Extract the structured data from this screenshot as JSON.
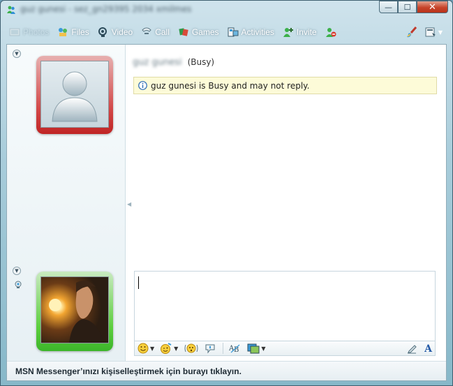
{
  "window": {
    "title": "guz gunesi - sez_gn29395 2034 xmilmes",
    "buttons": {
      "minimize": "—",
      "maximize": "☐",
      "close": "✕"
    }
  },
  "toolbar": {
    "items": [
      {
        "label": "Photos",
        "icon": "photos-icon",
        "enabled": false
      },
      {
        "label": "Files",
        "icon": "files-icon",
        "enabled": true
      },
      {
        "label": "Video",
        "icon": "video-icon",
        "enabled": true
      },
      {
        "label": "Call",
        "icon": "call-icon",
        "enabled": true
      },
      {
        "label": "Games",
        "icon": "games-icon",
        "enabled": true
      },
      {
        "label": "Activities",
        "icon": "activities-icon",
        "enabled": true
      },
      {
        "label": "Invite",
        "icon": "invite-icon",
        "enabled": true
      }
    ],
    "block_icon": "block-icon",
    "paint_icon": "paint-brush-icon",
    "menu_icon": "menu-icon"
  },
  "contact": {
    "name": "guz gunesi",
    "status": "(Busy)",
    "frame_color": "#d24545"
  },
  "notice": {
    "text": "guz gunesi is Busy and may not reply.",
    "icon": "info-icon"
  },
  "user": {
    "frame_color": "#5ccf3e"
  },
  "compose": {
    "value": "",
    "toolbar": {
      "emoticon": "emoticon-icon",
      "wink": "wink-icon",
      "nudge": "nudge-icon",
      "voice_clip": "voice-clip-icon",
      "spell_check": "spell-check-icon",
      "backgrounds": "backgrounds-icon",
      "handwriting": "handwriting-icon",
      "font": "A"
    }
  },
  "statusbar": {
    "text": "MSN Messenger’ınızı kişiselleştirmek için burayı tıklayın."
  }
}
